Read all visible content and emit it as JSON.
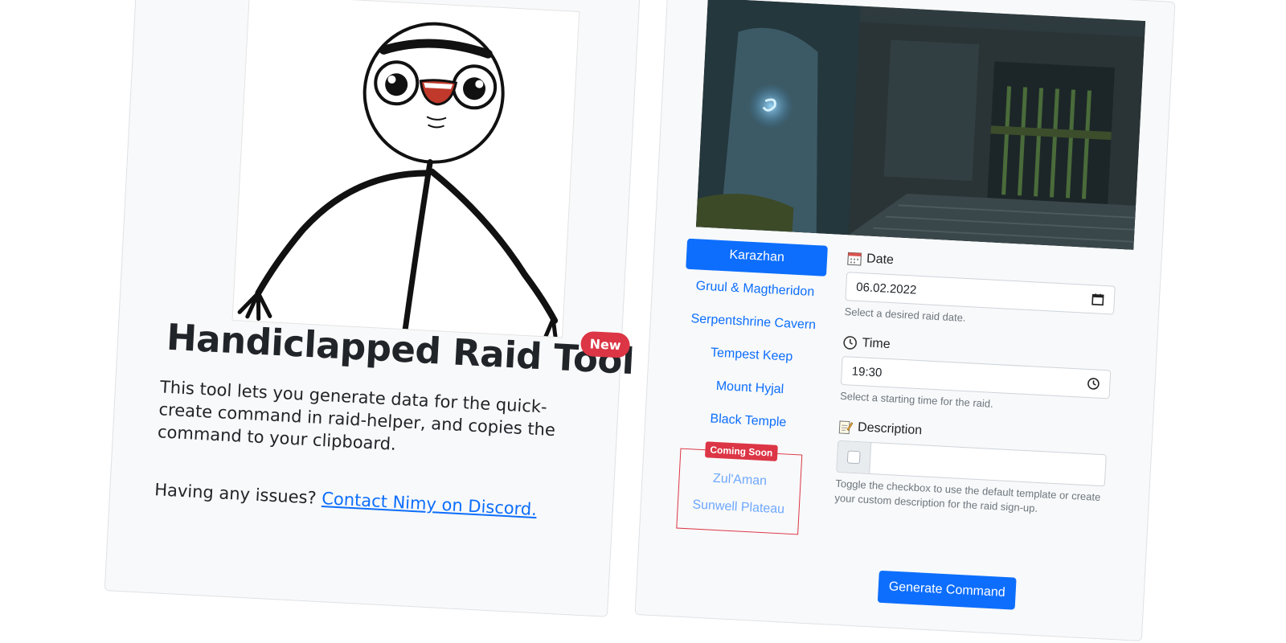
{
  "intro": {
    "title": "Handiclapped Raid Tool",
    "badge": "New",
    "description": "This tool lets you generate data for the quick-create command in raid-helper, and copies the command to your clipboard.",
    "issues_text": "Having any issues?",
    "contact_link": "Contact Nimy on Discord."
  },
  "raids": {
    "items": [
      {
        "label": "Karazhan",
        "active": true
      },
      {
        "label": "Gruul & Magtheridon"
      },
      {
        "label": "Serpentshrine Cavern"
      },
      {
        "label": "Tempest Keep"
      },
      {
        "label": "Mount Hyjal"
      },
      {
        "label": "Black Temple"
      }
    ],
    "coming_soon_badge": "Coming Soon",
    "coming_soon": [
      {
        "label": "Zul'Aman"
      },
      {
        "label": "Sunwell Plateau"
      }
    ]
  },
  "form": {
    "date": {
      "label": "Date",
      "value": "06.02.2022",
      "help": "Select a desired raid date.",
      "icon": "calendar-icon"
    },
    "time": {
      "label": "Time",
      "value": "19:30",
      "help": "Select a starting time for the raid.",
      "icon": "clock-icon"
    },
    "description": {
      "label": "Description",
      "value": "",
      "help": "Toggle the checkbox to use the default template or create your custom description for the raid sign-up.",
      "icon": "memo-icon"
    },
    "submit_label": "Generate Command"
  },
  "colors": {
    "primary": "#0d6efd",
    "danger": "#dc3545",
    "card_bg": "#f8f9fa"
  }
}
